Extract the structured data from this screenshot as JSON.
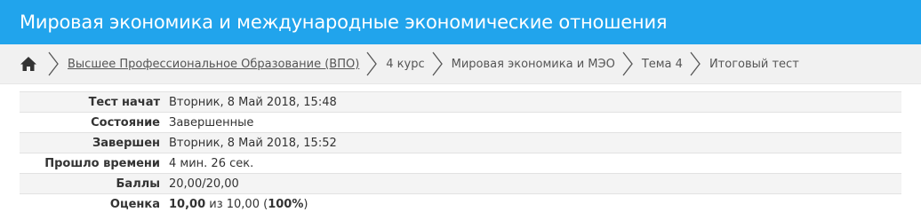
{
  "header": {
    "title": "Мировая экономика и международные экономические отношения"
  },
  "breadcrumb": {
    "items": [
      {
        "label": "Высшее Профессиональное Образование (ВПО)"
      },
      {
        "label": "4 курс"
      },
      {
        "label": "Мировая экономика и МЭО"
      },
      {
        "label": "Тема 4"
      },
      {
        "label": "Итоговый тест"
      }
    ]
  },
  "summary": {
    "rows": [
      {
        "label": "Тест начат",
        "value": "Вторник, 8 Май 2018, 15:48"
      },
      {
        "label": "Состояние",
        "value": "Завершенные"
      },
      {
        "label": "Завершен",
        "value": "Вторник, 8 Май 2018, 15:52"
      },
      {
        "label": "Прошло времени",
        "value": "4 мин. 26 сек."
      },
      {
        "label": "Баллы",
        "value": "20,00/20,00"
      },
      {
        "label": "Оценка",
        "grade": "10,00",
        "grade_of": "из 10,00 (",
        "percent": "100%",
        "close": ")"
      }
    ]
  },
  "colors": {
    "header_bg": "#21a4ec",
    "breadcrumb_bg": "#f1f1f1"
  },
  "icons": {
    "home": "home-icon",
    "separator": "chevron-right-icon"
  }
}
